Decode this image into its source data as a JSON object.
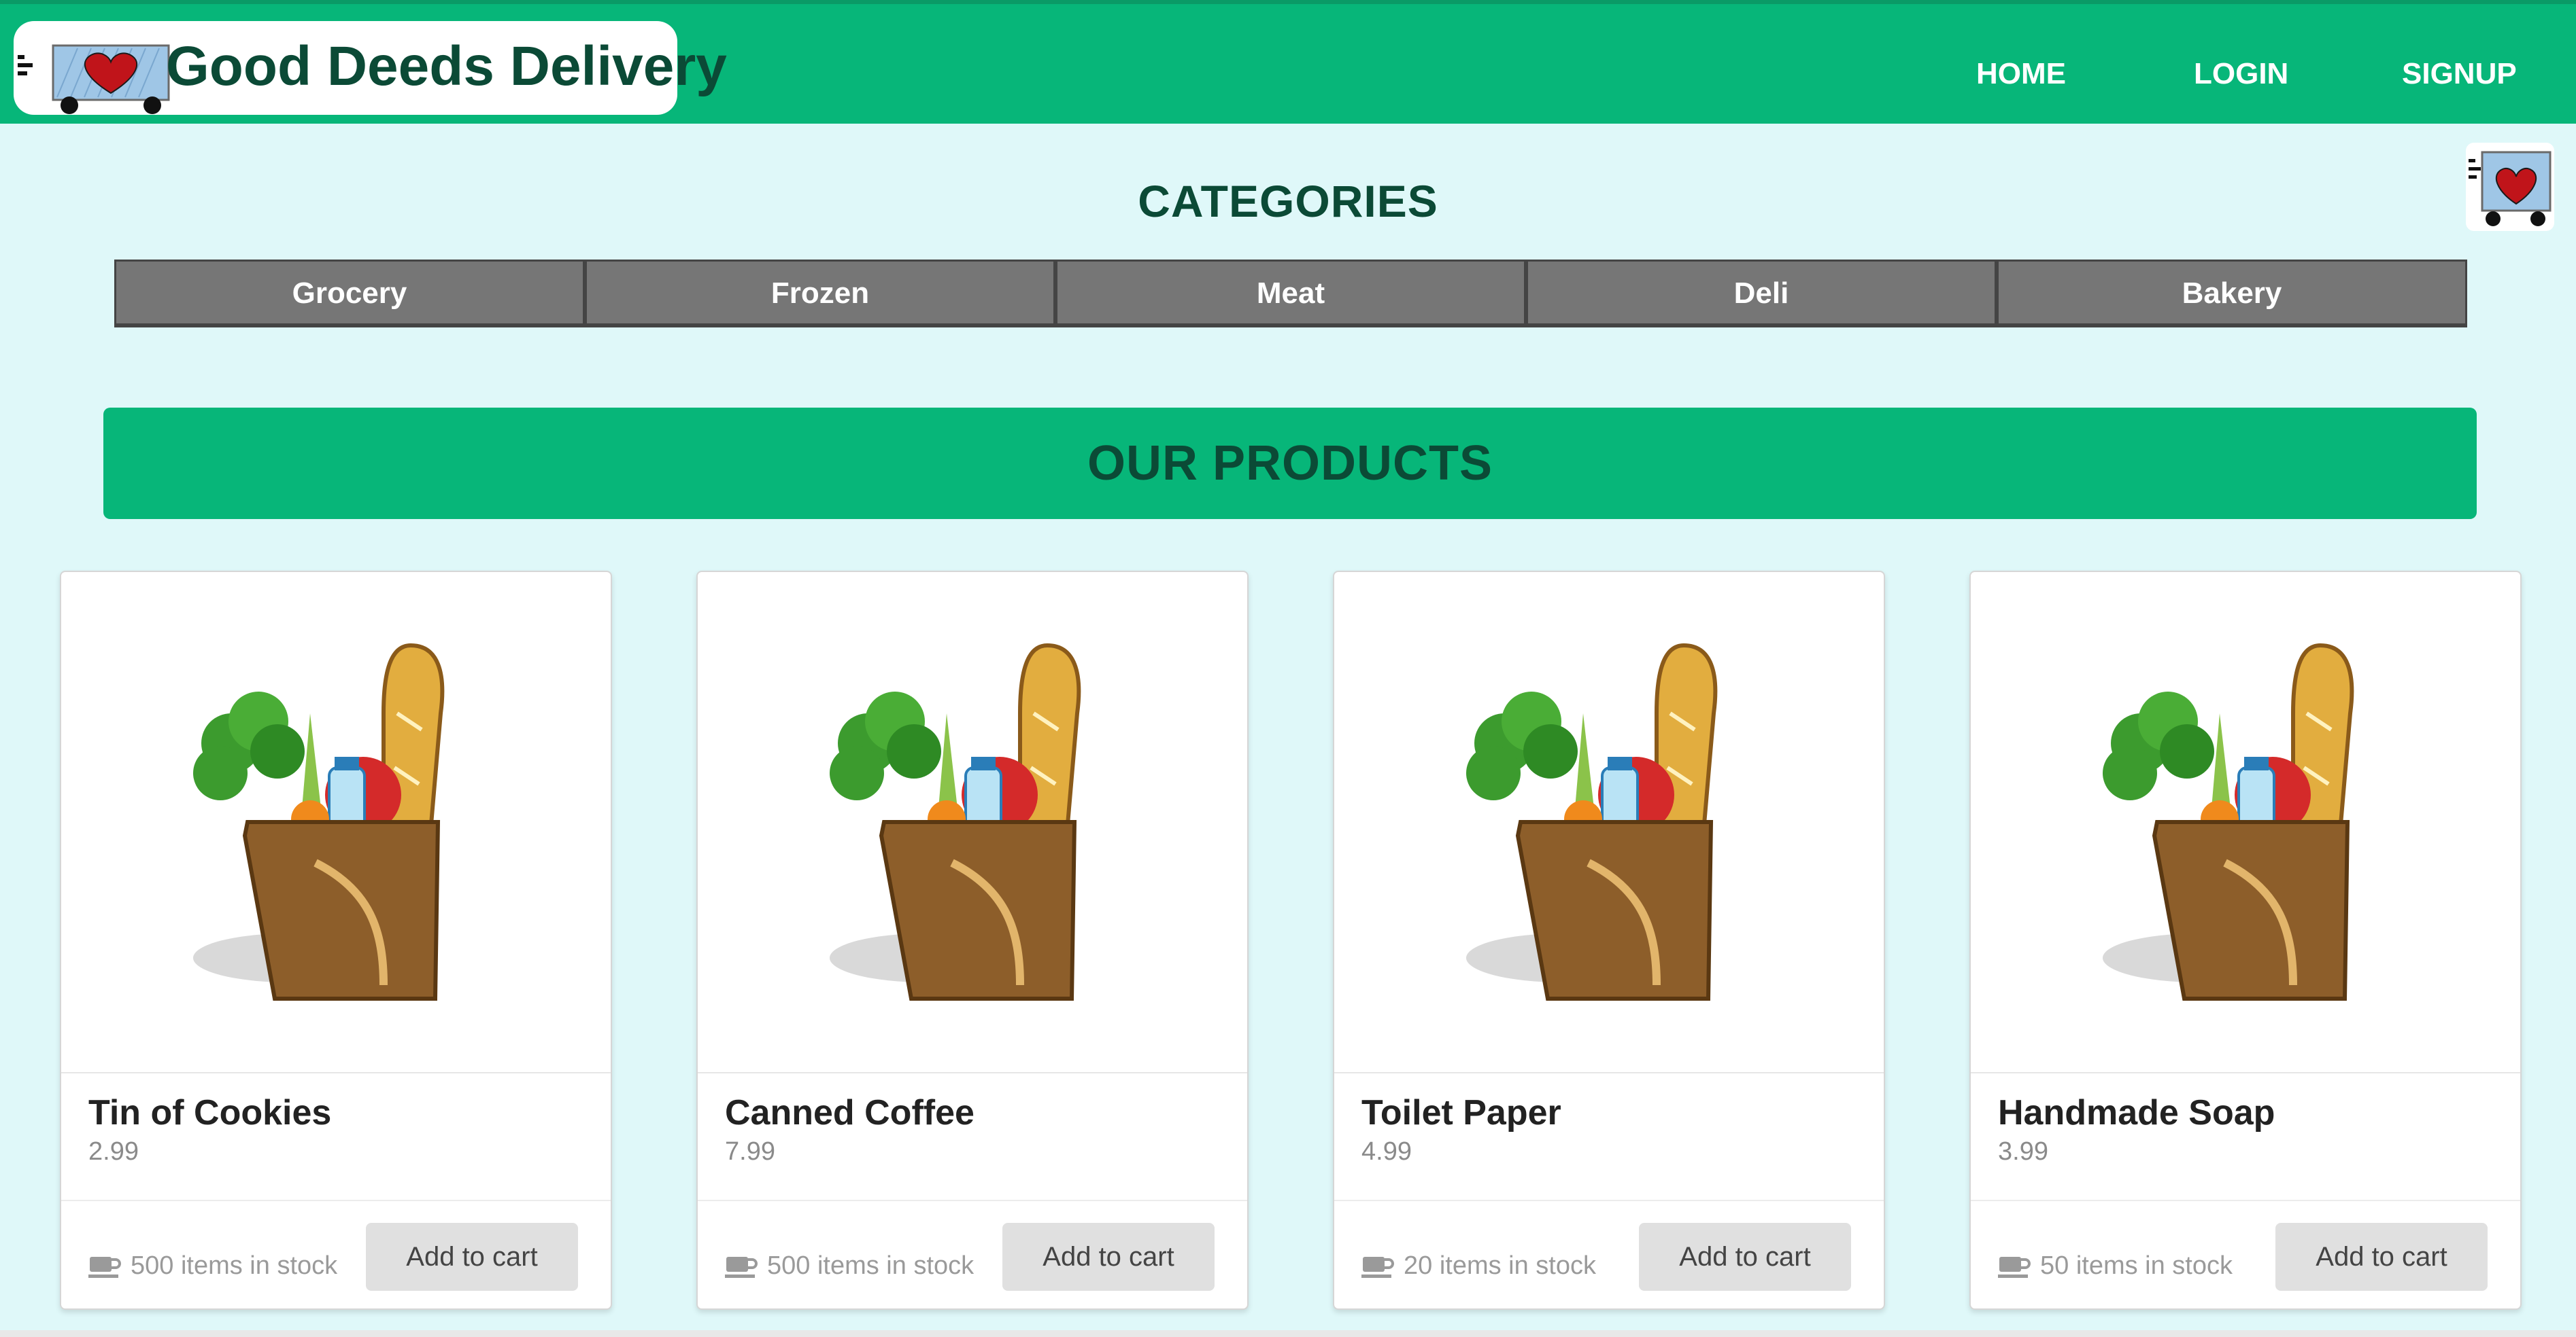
{
  "header": {
    "brand_name": "Good Deeds Delivery",
    "logo_icon": "delivery-truck-heart-icon",
    "nav": [
      {
        "label": "HOME"
      },
      {
        "label": "LOGIN"
      },
      {
        "label": "SIGNUP"
      }
    ]
  },
  "side_badge_icon": "delivery-truck-heart-icon",
  "categories": {
    "title": "CATEGORIES",
    "items": [
      {
        "label": "Grocery"
      },
      {
        "label": "Frozen"
      },
      {
        "label": "Meat"
      },
      {
        "label": "Deli"
      },
      {
        "label": "Bakery"
      }
    ]
  },
  "products": {
    "title": "OUR PRODUCTS",
    "items": [
      {
        "name": "Tin of Cookies",
        "price": "2.99",
        "stock": "500 items in stock",
        "button": "Add to cart"
      },
      {
        "name": "Canned Coffee",
        "price": "7.99",
        "stock": "500 items in stock",
        "button": "Add to cart"
      },
      {
        "name": "Toilet Paper",
        "price": "4.99",
        "stock": "20 items in stock",
        "button": "Add to cart"
      },
      {
        "name": "Handmade Soap",
        "price": "3.99",
        "stock": "50 items in stock",
        "button": "Add to cart"
      }
    ]
  },
  "colors": {
    "header_green": "#07b679",
    "page_bg": "#dff8f9",
    "title_dark_green": "#0b4a36",
    "category_gray": "#767676"
  }
}
